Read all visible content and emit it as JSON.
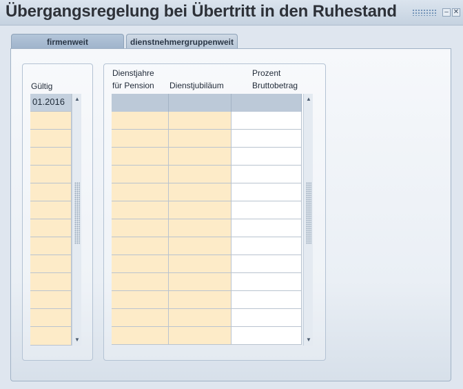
{
  "window": {
    "title": "Übergangsregelung bei Übertritt in den Ruhestand"
  },
  "tabs": [
    {
      "label": "firmenweit",
      "active": true
    },
    {
      "label": "dienstnehmergruppenweit",
      "active": false
    }
  ],
  "validity": {
    "label": "Gültig",
    "rows": [
      "01.2016",
      "",
      "",
      "",
      "",
      "",
      "",
      "",
      "",
      "",
      "",
      "",
      "",
      ""
    ]
  },
  "grid": {
    "columns": [
      {
        "label": "Dienstjahre\nfür Pension"
      },
      {
        "label": "Dienstjubiläum"
      },
      {
        "label": "Prozent\nBruttobetrag"
      }
    ],
    "row_count": 13
  },
  "icons": {
    "scroll_up": "chevron-up-icon",
    "scroll_down": "chevron-down-icon",
    "minimize": "minimize-icon",
    "close": "close-icon"
  },
  "colors": {
    "editable_cell": "#fdebc8",
    "plain_cell": "#ffffff",
    "header": "#bcc9d8"
  }
}
